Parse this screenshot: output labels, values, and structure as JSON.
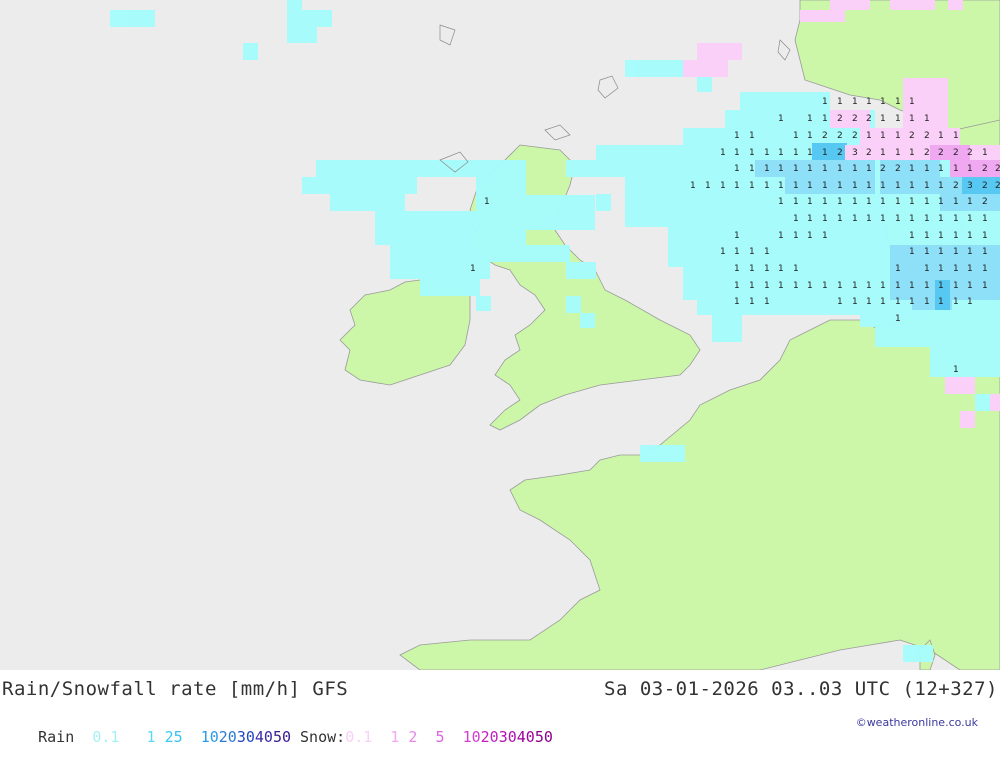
{
  "header": {
    "title_left": "Rain/Snowfall rate [mm/h] GFS",
    "title_right": "Sa 03-01-2026 03..03 UTC (12+327)"
  },
  "legend": {
    "rain_label": "Rain",
    "rain_values": [
      "0.1",
      "1",
      "2",
      "5",
      "10",
      "20",
      "30",
      "40",
      "50"
    ],
    "rain_colors": [
      "#a6f2f2",
      "#5ed8f5",
      "#38b6f0",
      "#38b6f0",
      "#2a8be0",
      "#2a6ad6",
      "#2244c0",
      "#3a2aa8",
      "#3a1a90"
    ],
    "snow_label": "Snow:",
    "snow_values": [
      "0.1",
      "1",
      "2",
      "5",
      "10",
      "20",
      "30",
      "40",
      "50"
    ],
    "snow_colors": [
      "#f8c8f8",
      "#f2a8f2",
      "#ea88ea",
      "#e060e0",
      "#d040d0",
      "#c020c0",
      "#b010b0",
      "#a000a0",
      "#8a008a"
    ]
  },
  "copyright": "©weatheronline.co.uk",
  "colors": {
    "sea": "#ececec",
    "land": "#ccf7a8",
    "rain_light": "#a6fcfc",
    "rain_medium": "#8ee0f8",
    "rain_heavy": "#56c8f2",
    "snow_light": "#fad0f8",
    "snow_medium": "#f0a8f0",
    "borders": "#8a8a8a"
  },
  "map_labels": {
    "row1": [
      "1",
      "1",
      "1",
      "1",
      "1",
      "1",
      "1"
    ],
    "row2": [
      "1",
      "1",
      "1",
      "2",
      "2",
      "2",
      "1",
      "1",
      "1",
      "1"
    ],
    "row3": [
      "1",
      "1",
      "1",
      "1",
      "2",
      "2",
      "2",
      "1",
      "1",
      "1",
      "2",
      "2",
      "1",
      "1"
    ],
    "row4": [
      "1",
      "1",
      "1",
      "1",
      "1",
      "1",
      "1",
      "1",
      "2",
      "3",
      "2",
      "1",
      "1",
      "1",
      "2",
      "2",
      "2",
      "2",
      "1"
    ],
    "row5": [
      "1",
      "1",
      "1",
      "1",
      "1",
      "1",
      "1",
      "1",
      "1",
      "1",
      "2",
      "2",
      "1",
      "1",
      "1",
      "1",
      "1",
      "2",
      "2",
      "2",
      "2"
    ],
    "row6": [
      "1",
      "1",
      "1",
      "1",
      "1",
      "1",
      "1",
      "1",
      "1",
      "1",
      "1",
      "1",
      "1",
      "1",
      "1",
      "1",
      "1",
      "1",
      "1",
      "2",
      "3",
      "2",
      "2"
    ],
    "row7": [
      "1",
      "1",
      "1",
      "1",
      "1",
      "1",
      "1",
      "1",
      "1",
      "1",
      "1",
      "1",
      "1",
      "1",
      "1",
      "2"
    ],
    "row8": [
      "1",
      "1",
      "1",
      "1",
      "1",
      "1",
      "1",
      "1",
      "1",
      "1",
      "1",
      "1",
      "1",
      "1"
    ],
    "row9": [
      "1",
      "1",
      "1",
      "1",
      "1",
      "1",
      "1",
      "1",
      "1",
      "1",
      "1"
    ],
    "row10": [
      "1",
      "1",
      "1",
      "1",
      "1",
      "1",
      "1",
      "1",
      "1",
      "1"
    ],
    "row11": [
      "1",
      "1",
      "1",
      "1",
      "1",
      "1",
      "1",
      "1",
      "1",
      "1",
      "1"
    ],
    "row12": [
      "1",
      "1",
      "1",
      "1",
      "1",
      "1",
      "1",
      "1",
      "1",
      "1",
      "1",
      "1",
      "1",
      "1",
      "1",
      "1",
      "1",
      "1",
      "1",
      "1"
    ],
    "row13": [
      "1",
      "1",
      "1",
      "1",
      "1",
      "1",
      "1",
      "1",
      "1",
      "1",
      "1",
      "1",
      "1",
      "1"
    ],
    "misc": [
      "1",
      "1",
      "1",
      "1"
    ]
  }
}
